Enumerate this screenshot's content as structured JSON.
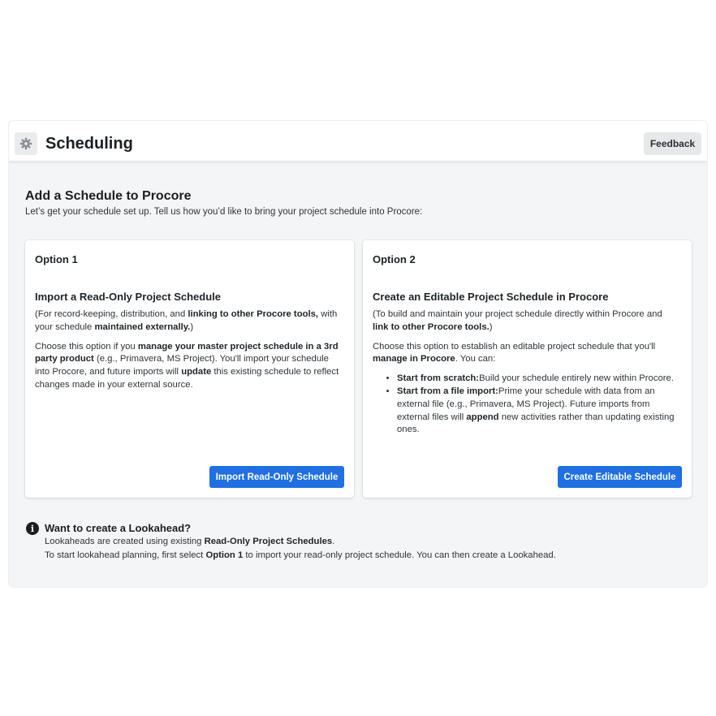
{
  "app": {
    "title": "Scheduling",
    "tool_icon": "gear-icon",
    "feedback_label": "Feedback"
  },
  "page": {
    "heading": "Add a Schedule to Procore",
    "subheading": "Let’s get your schedule set up. Tell us how you’d like to bring your project schedule into Procore:"
  },
  "option1": {
    "label": "Option 1",
    "title": "Import a Read-Only Project Schedule",
    "p1_a": "(For record-keeping, distribution, and ",
    "p1_b": "linking to other Procore tools,",
    "p1_c": " with your schedule ",
    "p1_d": "maintained externally.",
    "p1_e": ")",
    "p2_a": "Choose this option if you ",
    "p2_b": "manage your master project schedule in a 3rd party product",
    "p2_c": " (e.g., Primavera, MS Project). You'll import your schedule into Procore, and future imports will ",
    "p2_d": "update",
    "p2_e": " this existing schedule to reflect changes made in your external source.",
    "button_label": "Import Read-Only Schedule"
  },
  "option2": {
    "label": "Option 2",
    "title": "Create an Editable Project Schedule in Procore",
    "p1_a": "(To build and maintain your project schedule directly within Procore and ",
    "p1_b": "link to other Procore tools.",
    "p1_c": ")",
    "p2_a": "Choose this option to establish an editable project schedule that you'll ",
    "p2_b": "manage in Procore",
    "p2_c": ". You can:",
    "bullet1_bold": "Start from scratch:",
    "bullet1_text": "Build your schedule entirely new within Procore.",
    "bullet2_bold": "Start from a file import:",
    "bullet2_text_a": "Prime your schedule with data from an external file (e.g., Primavera, MS Project). Future imports from external files will ",
    "bullet2_bold2": "append",
    "bullet2_text_b": " new activities rather than updating existing ones.",
    "button_label": "Create Editable Schedule"
  },
  "lookahead": {
    "icon": "info-icon",
    "title": "Want to create a Lookahead?",
    "line1_a": "Lookaheads are created using existing ",
    "line1_b": "Read-Only Project Schedules",
    "line1_c": ".",
    "line2_a": "To start lookahead planning, first select ",
    "line2_b": "Option 1",
    "line2_c": " to import your read-only project schedule. You can then create a Lookahead."
  },
  "colors": {
    "primary_button": "#1f6fe5",
    "background": "#f4f5f6"
  }
}
